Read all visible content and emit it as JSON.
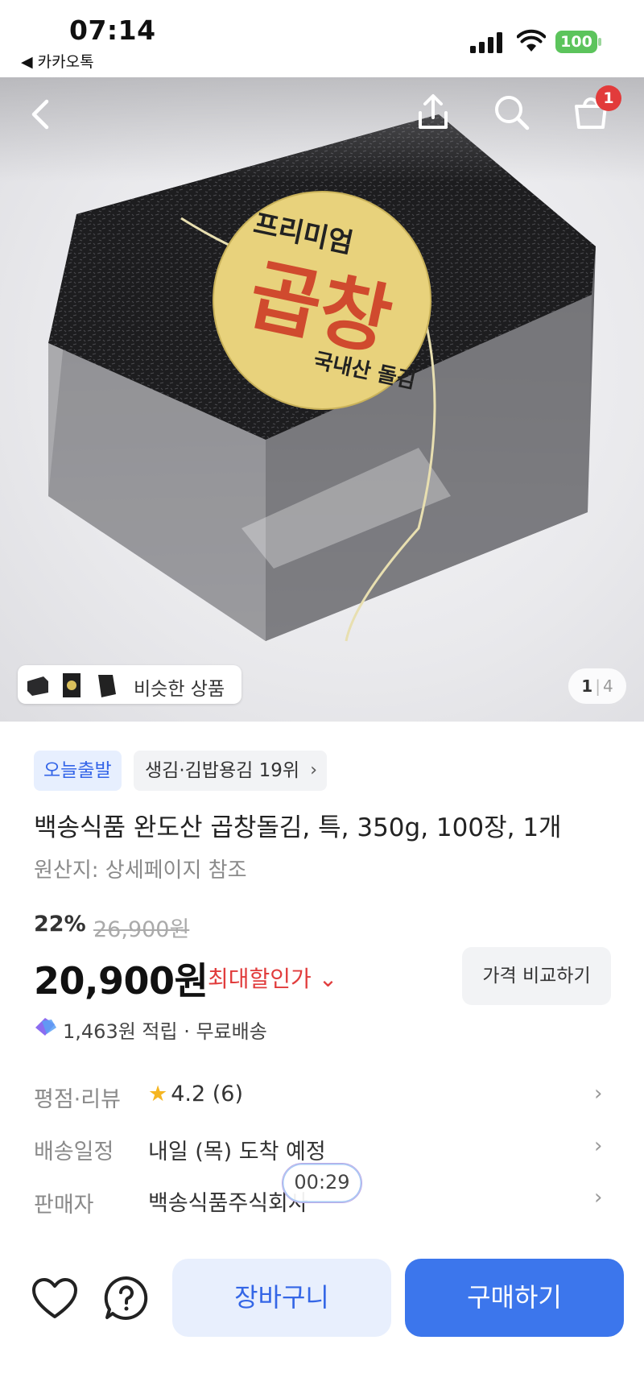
{
  "status_bar": {
    "time": "07:14",
    "back_app": "◀ 카카오톡",
    "battery": "100"
  },
  "hero": {
    "similar_label": "비슷한 상품",
    "pager": {
      "current": "1",
      "total": "4"
    },
    "cart_count": "1"
  },
  "product": {
    "badge_today": "오늘출발",
    "badge_rank": "생김·김밥용김 19위",
    "title": "백송식품 완도산 곱창돌김, 특, 350g, 100장, 1개",
    "origin": "원산지: 상세페이지 참조",
    "discount": "22%",
    "original_price": "26,900원",
    "price": "20,900원",
    "max_discount": "최대할인가 ⌄",
    "compare_button": "가격 비교하기",
    "reward": "1,463원 적립 · 무료배송"
  },
  "rows": {
    "rating_label": "평점·리뷰",
    "rating_value": "4.2 (6)",
    "shipping_label": "배송일정",
    "shipping_value": "내일 (목) 도착 예정",
    "seller_label": "판매자",
    "seller_value": "백송식품주식회사"
  },
  "timer": "00:29",
  "bottom": {
    "cart_button": "장바구니",
    "buy_button": "구매하기"
  },
  "colors": {
    "accent": "#3c76ec",
    "sale": "#e13c3c",
    "badge_red": "#e23b3b",
    "battery_green": "#5cc45c"
  }
}
